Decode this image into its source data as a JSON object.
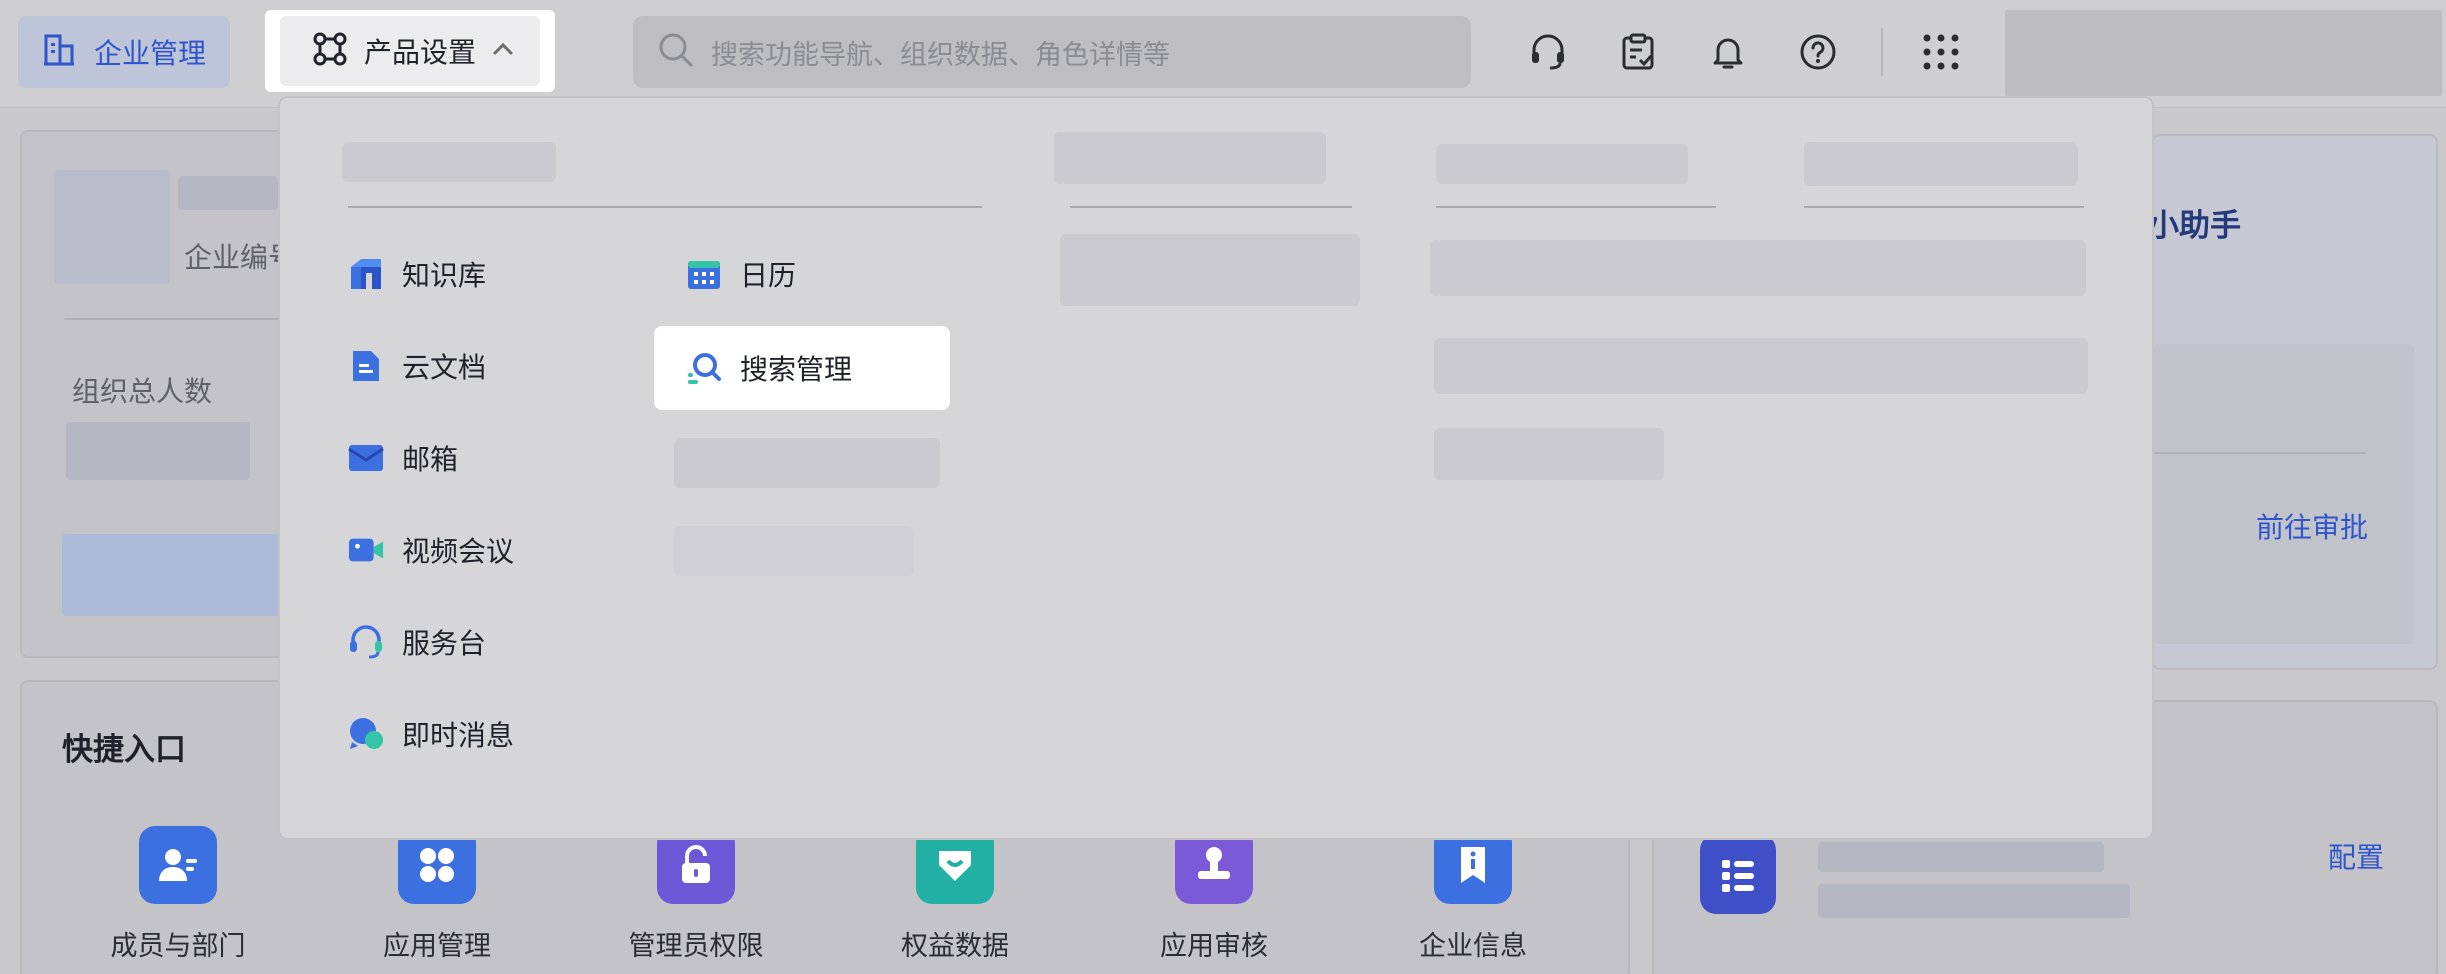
{
  "topbar": {
    "brand_label": "企业管理",
    "product_label": "产品设置",
    "search_placeholder": "搜索功能导航、组织数据、角色详情等",
    "icons": [
      "headset-icon",
      "clipboard-check-icon",
      "bell-icon",
      "help-icon",
      "apps-grid-icon"
    ]
  },
  "left_panel": {
    "enterprise_id_label": "企业编号",
    "org_total_label": "组织总人数"
  },
  "right_panel": {
    "assistant_title": "小助手",
    "approve_link": "前往审批",
    "config_link": "配置"
  },
  "quick_entry": {
    "title": "快捷入口",
    "items": [
      {
        "label": "成员与部门",
        "icon": "member-icon",
        "color": "#3c6fe0"
      },
      {
        "label": "应用管理",
        "icon": "app-grid-icon",
        "color": "#3c6fe0"
      },
      {
        "label": "管理员权限",
        "icon": "unlock-icon",
        "color": "#6d58d8"
      },
      {
        "label": "权益数据",
        "icon": "gem-icon",
        "color": "#23b0a4"
      },
      {
        "label": "应用审核",
        "icon": "stamp-icon",
        "color": "#7a5ad6"
      },
      {
        "label": "企业信息",
        "icon": "info-badge-icon",
        "color": "#3c6fe0"
      }
    ]
  },
  "dropdown": {
    "col1": [
      {
        "label": "知识库",
        "icon": "wiki-icon"
      },
      {
        "label": "云文档",
        "icon": "doc-icon"
      },
      {
        "label": "邮箱",
        "icon": "mail-icon"
      },
      {
        "label": "视频会议",
        "icon": "video-icon"
      },
      {
        "label": "服务台",
        "icon": "helpdesk-icon"
      },
      {
        "label": "即时消息",
        "icon": "chat-icon"
      }
    ],
    "col2": [
      {
        "label": "日历",
        "icon": "calendar-icon"
      },
      {
        "label": "搜索管理",
        "icon": "search-manage-icon",
        "active": true
      }
    ]
  },
  "colors": {
    "accent": "#2e55cc",
    "brand_blue": "#3c6fe0"
  }
}
